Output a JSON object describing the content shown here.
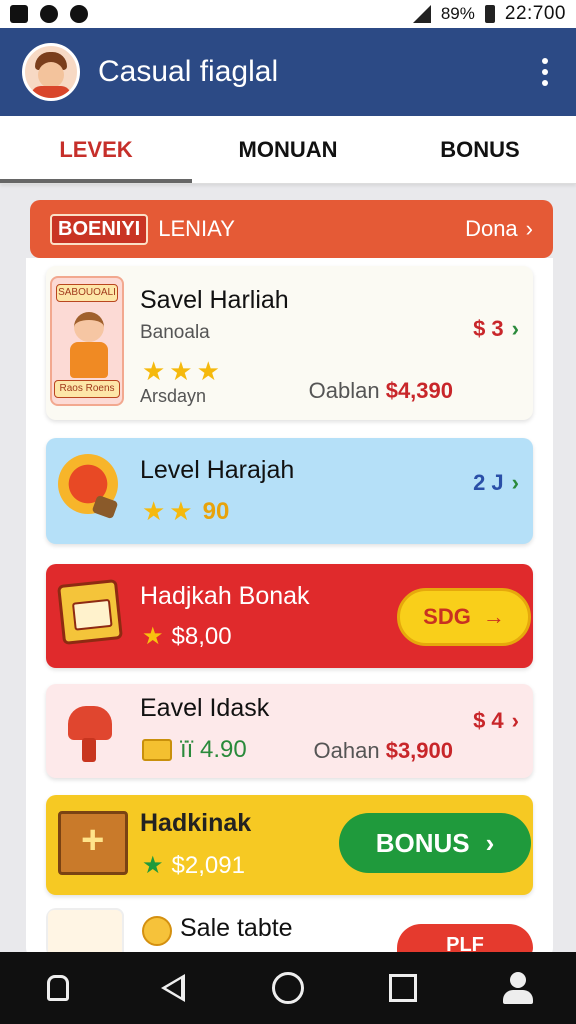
{
  "status": {
    "battery": "89%",
    "time": "22:700"
  },
  "appbar": {
    "title": "Casual fiaglal"
  },
  "tabs": [
    {
      "label": "LEVEK",
      "active": true
    },
    {
      "label": "MONUAN",
      "active": false
    },
    {
      "label": "BONUS",
      "active": false
    }
  ],
  "banner": {
    "badge": "BOENIYI",
    "title": "LENIAY",
    "link": "Dona"
  },
  "cards": [
    {
      "title": "Savel Harliah",
      "subtitle": "Banoala",
      "tag_top": "SABOUOALI",
      "tag_bottom": "Raos Roens",
      "stars": "★★★",
      "caption": "Arsdayn",
      "right_value": "$ 3",
      "price_label": "Oablan",
      "price_amount": "$4,390"
    },
    {
      "title": "Level Harajah",
      "stars": "★★",
      "stars_value": "90",
      "right_value": "2 J"
    },
    {
      "title": "Hadjkah Bonak",
      "amount": "$8,00",
      "button_label": "SDG"
    },
    {
      "title": "Eavel Idask",
      "value": "ïï 4.90",
      "right_value": "$ 4",
      "price_label": "Oahan",
      "price_amount": "$3,900"
    },
    {
      "title": "Hadkinak",
      "amount": "$2,091",
      "button_label": "BONUS"
    },
    {
      "title": "Sale tabte",
      "button_label": "PLF"
    }
  ],
  "colors": {
    "appbar": "#2c4a85",
    "accent_red": "#c62f2a",
    "banner": "#e55a36",
    "green": "#1f9a3c",
    "yellow": "#f6c923"
  }
}
